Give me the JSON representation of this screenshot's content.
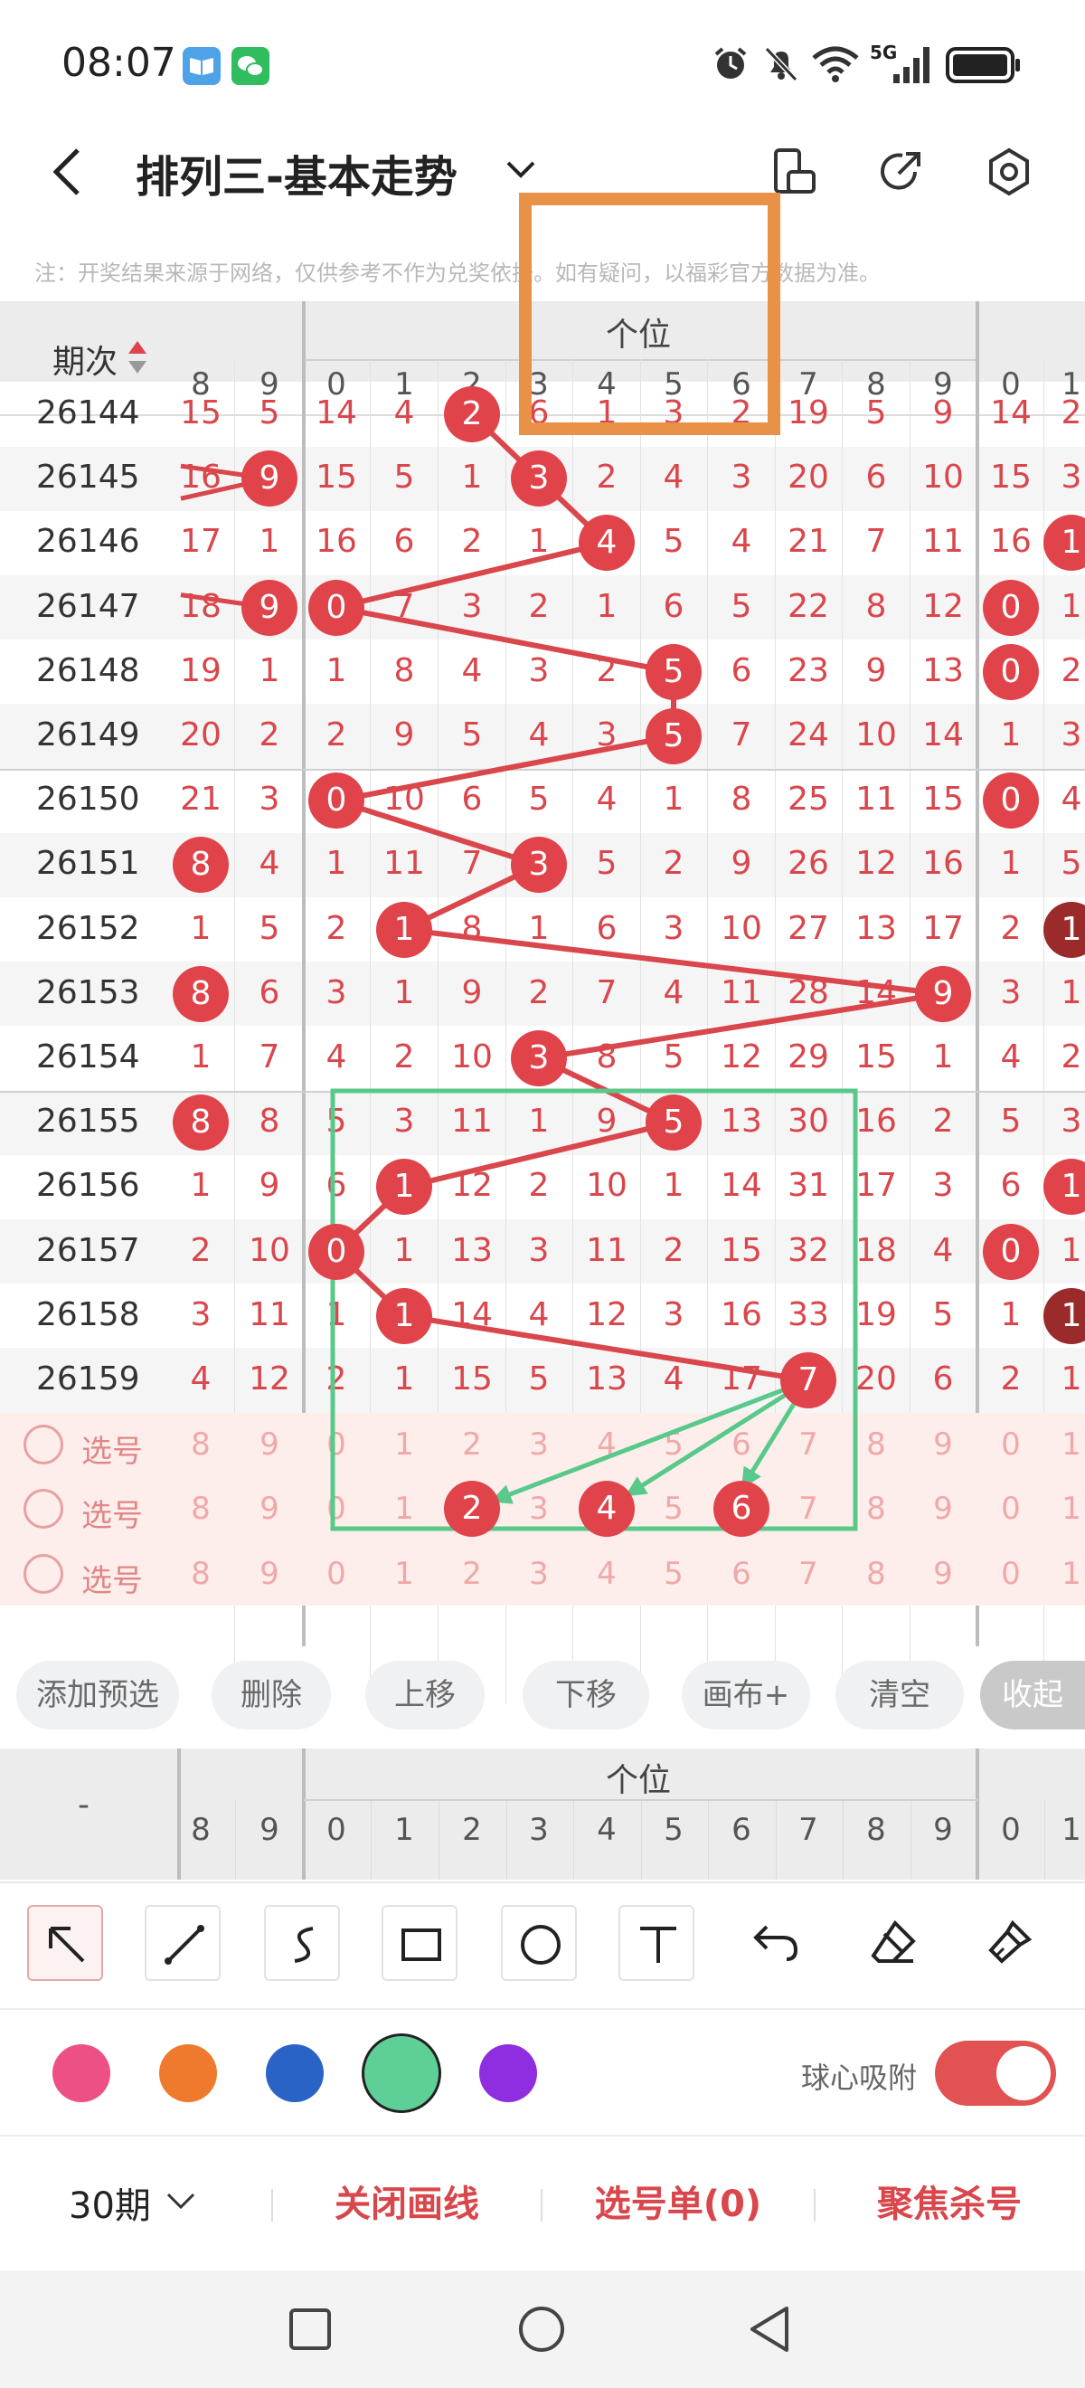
{
  "status_bar": {
    "time": "08:07",
    "network": "5G"
  },
  "header": {
    "title": "排列三-基本走势"
  },
  "notice": "注：开奖结果来源于网络，仅供参考不作为兑奖依据。如有疑问，以福彩官方数据为准。",
  "table": {
    "period_label": "期次",
    "section_label": "个位",
    "columns_left": [
      "8",
      "9"
    ],
    "columns_main": [
      "0",
      "1",
      "2",
      "3",
      "4",
      "5",
      "6",
      "7",
      "8",
      "9"
    ],
    "columns_right": [
      "0",
      "1"
    ],
    "rows": [
      {
        "period": "26144",
        "left": [
          "15",
          "5"
        ],
        "main": [
          "14",
          "4",
          "2",
          "6",
          "1",
          "3",
          "2",
          "19",
          "5",
          "9"
        ],
        "right": [
          "14",
          "2"
        ]
      },
      {
        "period": "26145",
        "left": [
          "16",
          "9"
        ],
        "main": [
          "15",
          "5",
          "1",
          "3",
          "2",
          "4",
          "3",
          "20",
          "6",
          "10"
        ],
        "right": [
          "15",
          "3"
        ]
      },
      {
        "period": "26146",
        "left": [
          "17",
          "1"
        ],
        "main": [
          "16",
          "6",
          "2",
          "1",
          "4",
          "5",
          "4",
          "21",
          "7",
          "11"
        ],
        "right": [
          "16",
          "1"
        ]
      },
      {
        "period": "26147",
        "left": [
          "18",
          "9"
        ],
        "main": [
          "0",
          "7",
          "3",
          "2",
          "1",
          "6",
          "5",
          "22",
          "8",
          "12"
        ],
        "right": [
          "0",
          "1"
        ]
      },
      {
        "period": "26148",
        "left": [
          "19",
          "1"
        ],
        "main": [
          "1",
          "8",
          "4",
          "3",
          "2",
          "5",
          "6",
          "23",
          "9",
          "13"
        ],
        "right": [
          "0",
          "2"
        ]
      },
      {
        "period": "26149",
        "left": [
          "20",
          "2"
        ],
        "main": [
          "2",
          "9",
          "5",
          "4",
          "3",
          "5",
          "7",
          "24",
          "10",
          "14"
        ],
        "right": [
          "1",
          "3"
        ]
      },
      {
        "period": "26150",
        "left": [
          "21",
          "3"
        ],
        "main": [
          "0",
          "10",
          "6",
          "5",
          "4",
          "1",
          "8",
          "25",
          "11",
          "15"
        ],
        "right": [
          "0",
          "4"
        ]
      },
      {
        "period": "26151",
        "left": [
          "8",
          "4"
        ],
        "main": [
          "1",
          "11",
          "7",
          "3",
          "5",
          "2",
          "9",
          "26",
          "12",
          "16"
        ],
        "right": [
          "1",
          "5"
        ]
      },
      {
        "period": "26152",
        "left": [
          "1",
          "5"
        ],
        "main": [
          "2",
          "1",
          "8",
          "1",
          "6",
          "3",
          "10",
          "27",
          "13",
          "17"
        ],
        "right": [
          "2",
          "1"
        ]
      },
      {
        "period": "26153",
        "left": [
          "8",
          "6"
        ],
        "main": [
          "3",
          "1",
          "9",
          "2",
          "7",
          "4",
          "11",
          "28",
          "14",
          "9"
        ],
        "right": [
          "3",
          "1"
        ]
      },
      {
        "period": "26154",
        "left": [
          "1",
          "7"
        ],
        "main": [
          "4",
          "2",
          "10",
          "3",
          "8",
          "5",
          "12",
          "29",
          "15",
          "1"
        ],
        "right": [
          "4",
          "2"
        ]
      },
      {
        "period": "26155",
        "left": [
          "8",
          "8"
        ],
        "main": [
          "5",
          "3",
          "11",
          "1",
          "9",
          "5",
          "13",
          "30",
          "16",
          "2"
        ],
        "right": [
          "5",
          "3"
        ]
      },
      {
        "period": "26156",
        "left": [
          "1",
          "9"
        ],
        "main": [
          "6",
          "1",
          "12",
          "2",
          "10",
          "1",
          "14",
          "31",
          "17",
          "3"
        ],
        "right": [
          "6",
          "1"
        ]
      },
      {
        "period": "26157",
        "left": [
          "2",
          "10"
        ],
        "main": [
          "0",
          "1",
          "13",
          "3",
          "11",
          "2",
          "15",
          "32",
          "18",
          "4"
        ],
        "right": [
          "0",
          "1"
        ]
      },
      {
        "period": "26158",
        "left": [
          "3",
          "11"
        ],
        "main": [
          "1",
          "1",
          "14",
          "4",
          "12",
          "3",
          "16",
          "33",
          "19",
          "5"
        ],
        "right": [
          "1",
          "1"
        ]
      },
      {
        "period": "26159",
        "left": [
          "4",
          "12"
        ],
        "main": [
          "2",
          "1",
          "15",
          "5",
          "13",
          "4",
          "17",
          "7",
          "20",
          "6"
        ],
        "right": [
          "2",
          "1"
        ]
      }
    ],
    "hits": [
      2,
      3,
      4,
      0,
      5,
      5,
      0,
      3,
      1,
      9,
      3,
      5,
      1,
      0,
      1,
      7
    ],
    "left_hits": [
      null,
      "9",
      null,
      "9",
      null,
      null,
      null,
      "8",
      null,
      "8",
      null,
      "8",
      null,
      null,
      null,
      null
    ],
    "right_hits": [
      null,
      null,
      "1",
      "0",
      "0",
      null,
      "0",
      null,
      "1",
      null,
      null,
      null,
      "1",
      "0",
      "1",
      null
    ],
    "dark_right_hits": [
      8,
      14
    ],
    "select_label": "选号",
    "select_rows": [
      {
        "left": [
          "8",
          "9"
        ],
        "main": [
          "0",
          "1",
          "2",
          "3",
          "4",
          "5",
          "6",
          "7",
          "8",
          "9"
        ],
        "right": [
          "0",
          "1"
        ]
      },
      {
        "left": [
          "8",
          "9"
        ],
        "main": [
          "0",
          "1",
          "2",
          "3",
          "4",
          "5",
          "6",
          "7",
          "8",
          "9"
        ],
        "right": [
          "0",
          "1"
        ]
      },
      {
        "left": [
          "8",
          "9"
        ],
        "main": [
          "0",
          "1",
          "2",
          "3",
          "4",
          "5",
          "6",
          "7",
          "8",
          "9"
        ],
        "right": [
          "0",
          "1"
        ]
      }
    ],
    "selected_main": [
      2,
      4,
      6
    ]
  },
  "actions": [
    "添加预选",
    "删除",
    "上移",
    "下移",
    "画布+",
    "清空",
    "收起"
  ],
  "summary_header": {
    "left_label": "-",
    "section_label": "个位"
  },
  "palette": {
    "colors": [
      "#ec5085",
      "#ef7a2e",
      "#2a63c6",
      "#5fcf98",
      "#8e2ee0"
    ],
    "selected": 3,
    "magnet_label": "球心吸附",
    "magnet_on": true
  },
  "bottom_bar": {
    "period_select": "30期",
    "close_lines": "关闭画线",
    "picks": "选号单(0)",
    "focus_kill": "聚焦杀号"
  },
  "colors": {
    "ball": "#e0434a",
    "line": "#d9464b",
    "green": "#58c98a",
    "orange": "#ea9148",
    "dark_ball": "#9b2b2a"
  }
}
